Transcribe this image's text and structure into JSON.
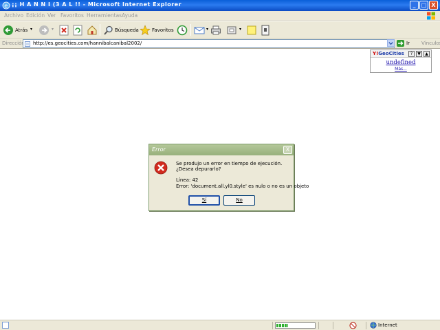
{
  "window": {
    "title": "¡¡ H A N N I (3 A L !! - Microsoft Internet Explorer",
    "controls": {
      "minimize": "_",
      "maximize": "□",
      "close": "X"
    }
  },
  "menu": [
    "Archivo",
    "Edición",
    "Ver",
    "Favoritos",
    "Herramientas",
    "Ayuda"
  ],
  "toolbar": {
    "back_label": "Atrás",
    "search_label": "Búsqueda",
    "favorites_label": "Favoritos"
  },
  "address": {
    "label": "Dirección",
    "url": "http://es.geocities.com/hannibalcanibal2002/",
    "go_label": "Ir",
    "links_label": "Vínculos"
  },
  "geocities_widget": {
    "logo_prefix": "Y!",
    "logo_name": "GeoCities",
    "help": "?",
    "down": "▼",
    "up": "▲",
    "link_text": "undefined",
    "more_text": "Más..."
  },
  "error_dialog": {
    "title": "Error",
    "close": "X",
    "line1": "Se produjo un error en tiempo de ejecución.",
    "line2": "¿Desea depurarlo?",
    "line3": "Línea: 42",
    "line4": "Error: 'document.all.yl0.style' es nulo o no es un objeto",
    "yes_label": "Sí",
    "no_label": "No"
  },
  "status_bar": {
    "zone_label": "Internet",
    "progress_fraction": 0.3
  },
  "colors": {
    "titlebar": "#0a5fd8",
    "dialog_title": "#98b07c",
    "error_icon": "#d22a1e"
  }
}
